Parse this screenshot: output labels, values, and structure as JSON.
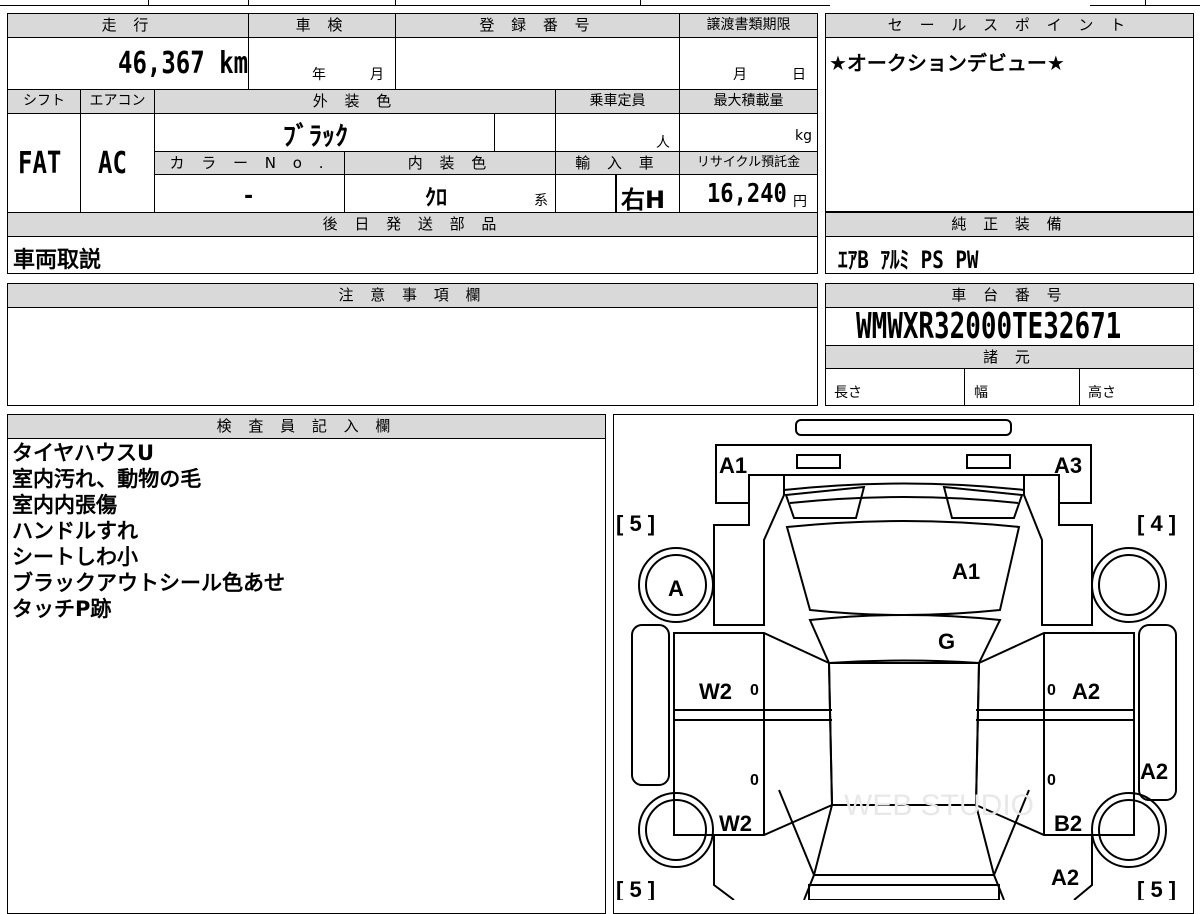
{
  "header": {
    "mileage_label": "走 行",
    "shaken_label": "車 検",
    "registration_label": "登 録 番 号",
    "transfer_label": "譲渡書類期限",
    "mileage_value": "46,367 km",
    "year_unit": "年",
    "month_unit": "月",
    "transfer_month": "月",
    "transfer_day": "日"
  },
  "row2": {
    "shift_label": "シフト",
    "ac_label": "エアコン",
    "color_label": "外 装 色",
    "capacity_label": "乗車定員",
    "load_label": "最大積載量",
    "shift_value": "FAT",
    "ac_value": "AC",
    "color_value": "ﾌﾞﾗｯｸ",
    "capacity_unit": "人",
    "load_unit": "kg",
    "color_no_label": "カ ラ ー N o .",
    "interior_label": "内 装 色",
    "import_label": "輸 入 車",
    "recycle_label": "リサイクル預託金",
    "color_no_value": "-",
    "interior_value": "ｸﾛ",
    "interior_suffix": "系",
    "import_value": "右H",
    "recycle_value": "16,240",
    "recycle_unit": "円"
  },
  "later_parts": {
    "label": "後 日 発 送 部 品",
    "value": "車両取説"
  },
  "sales_point": {
    "label": "セ ー ル ス ポ イ ン ト",
    "value": "★オークションデビュー★"
  },
  "equipment": {
    "label": "純 正 装 備",
    "value": "ｴｱB ｱﾙﾐ PS PW"
  },
  "caution": {
    "label": "注 意 事 項 欄"
  },
  "chassis": {
    "label": "車 台 番 号",
    "value": "WMWXR32000TE32671",
    "spec_label": "諸 元",
    "length_label": "長さ",
    "width_label": "幅",
    "height_label": "高さ"
  },
  "inspector": {
    "label": "検 査 員 記 入 欄",
    "notes": [
      "タイヤハウスU",
      "室内汚れ、動物の毛",
      "室内内張傷",
      "ハンドルすれ",
      "シートしわ小",
      "ブラックアウトシール色あせ",
      "タッチP跡"
    ]
  },
  "diagram": {
    "marks": {
      "front_left": "A1",
      "front_right": "A3",
      "hood": "A1",
      "windshield": "G",
      "front_left_tire": "A",
      "front_left_door": "W2",
      "rear_left_door": "W2",
      "front_right_door": "A2",
      "right_fender": "A2",
      "rear_right_door": "B2",
      "rear_right": "A2",
      "tire_fl": "[ 5 ]",
      "tire_fr": "[ 4 ]",
      "tire_rl": "[ 5 ]",
      "tire_rr": "[ 5 ]",
      "zero": "0"
    },
    "watermark": "WEB STUDIO"
  }
}
